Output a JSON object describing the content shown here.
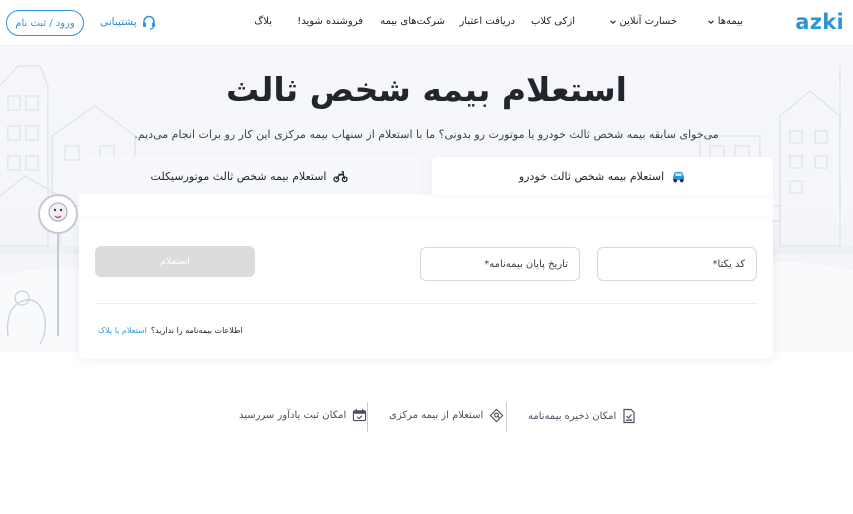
{
  "header": {
    "logo": "azki",
    "nav": [
      {
        "label": "بیمه‌ها",
        "has_dropdown": true
      },
      {
        "label": "خسارت آنلاین",
        "has_dropdown": true
      },
      {
        "label": "ازکی کلاب",
        "has_dropdown": false
      },
      {
        "label": "دریافت اعتبار",
        "has_dropdown": false
      },
      {
        "label": "شرکت‌های بیمه",
        "has_dropdown": false
      },
      {
        "label": "فروشنده شوید!",
        "has_dropdown": false
      },
      {
        "label": "بلاگ",
        "has_dropdown": false
      }
    ],
    "support_label": "پشتیبانی",
    "support_icon": "headset-icon",
    "login_label": "ورود / ثبت نام"
  },
  "hero": {
    "title": "استعلام بیمه شخص ثالث",
    "subtitle": "می‌خوای سابقه بیمه شخص ثالث خودرو یا موتورت رو بدونی؟ ما با استعلام از سنهاب بیمه مرکزی این کار رو برات انجام می‌دیم."
  },
  "tabs": [
    {
      "label": "استعلام بیمه شخص ثالث خودرو",
      "icon": "car-icon",
      "active": true
    },
    {
      "label": "استعلام بیمه شخص ثالث موتورسیکلت",
      "icon": "motorcycle-icon",
      "active": false
    }
  ],
  "form": {
    "code_placeholder": "کد یکتا*",
    "date_placeholder": "تاریخ پایان بیمه‌نامه*",
    "submit_label": "استعلام",
    "no_info_text": "اطلاعات بیمه‌نامه را ندارید؟",
    "plate_link": "استعلام با پلاک"
  },
  "features": [
    {
      "label": "امکان ذخیره بیمه‌نامه",
      "icon": "save-document-icon"
    },
    {
      "label": "استعلام از بیمه مرکزی",
      "icon": "inquiry-tag-icon"
    },
    {
      "label": "امکان ثبت یادآور سررسید",
      "icon": "calendar-reminder-icon"
    }
  ],
  "colors": {
    "brand": "#2f95d7",
    "text": "#202532",
    "disabled_button": "#dcdcde"
  }
}
